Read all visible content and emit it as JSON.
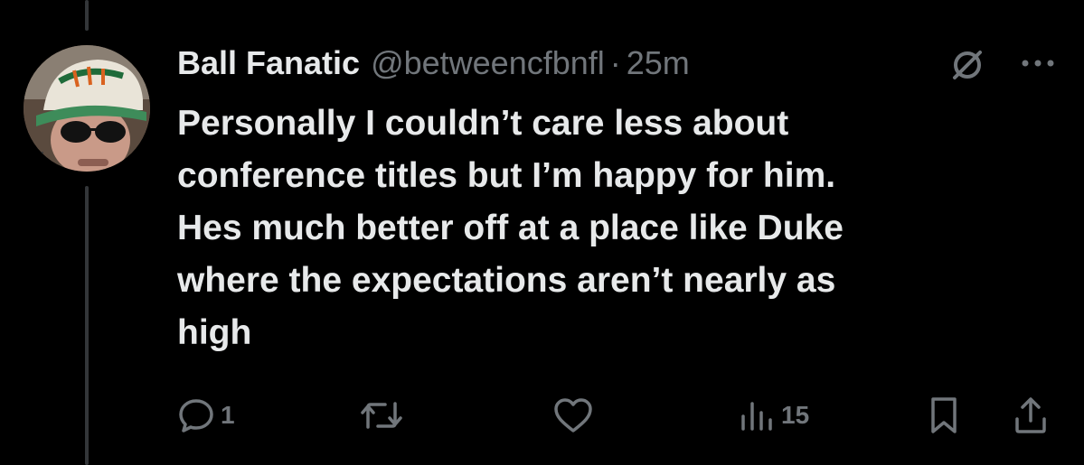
{
  "tweet": {
    "author_name": "Ball Fanatic",
    "handle": "@betweencfbnfl",
    "separator": "·",
    "time": "25m",
    "text": "Personally I couldn’t care less about\nconference titles but I’m happy for him.\nHes much better off at a place like Duke\nwhere the expectations aren’t nearly as\nhigh"
  },
  "actions": {
    "reply_count": "1",
    "views_count": "15"
  },
  "icons": {
    "grok": "grok-icon",
    "more": "more-icon",
    "reply": "reply-icon",
    "retweet": "retweet-icon",
    "like": "heart-icon",
    "views": "views-icon",
    "bookmark": "bookmark-icon",
    "share": "share-icon"
  },
  "colors": {
    "background": "#000000",
    "text": "#e7e9ea",
    "secondary": "#71767b",
    "thread_line": "#333639"
  }
}
